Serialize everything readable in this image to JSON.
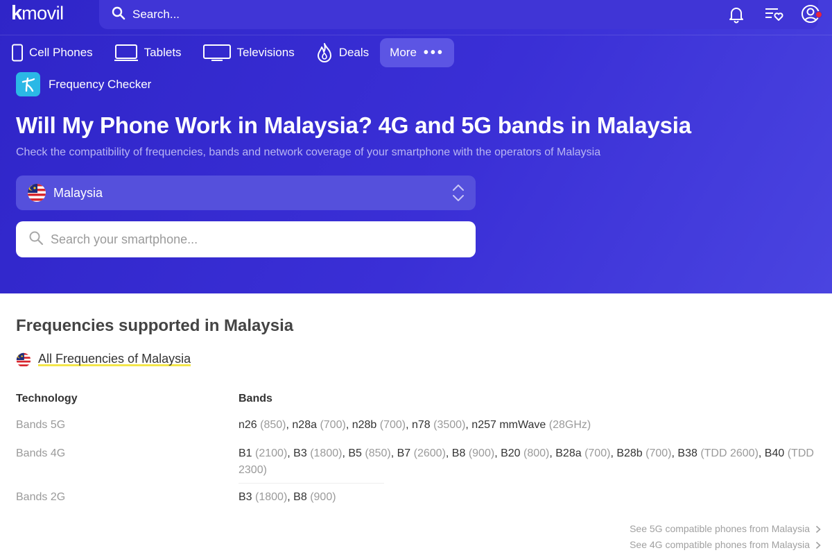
{
  "brand": {
    "logo_k": "k",
    "logo_rest": "movil"
  },
  "topbar": {
    "search_label": "Search...",
    "icons": [
      "bell-icon",
      "wishlist-icon",
      "user-account-icon"
    ]
  },
  "nav": {
    "items": [
      {
        "label": "Cell Phones",
        "icon": "phone-icon"
      },
      {
        "label": "Tablets",
        "icon": "tablet-icon"
      },
      {
        "label": "Televisions",
        "icon": "tv-icon"
      },
      {
        "label": "Deals",
        "icon": "flame-icon"
      }
    ],
    "more_label": "More",
    "more_dots": "•••"
  },
  "tool": {
    "label": "Frequency Checker"
  },
  "hero": {
    "title": "Will My Phone Work in Malaysia? 4G and 5G bands in Malaysia",
    "subtitle": "Check the compatibility of frequencies, bands and network coverage of your smartphone with the operators of Malaysia",
    "country_selected": "Malaysia",
    "phone_search_placeholder": "Search your smartphone..."
  },
  "frequencies": {
    "section_title": "Frequencies supported in Malaysia",
    "all_label": "All Frequencies of Malaysia",
    "col_technology": "Technology",
    "col_bands": "Bands",
    "rows": [
      {
        "technology": "Bands 5G",
        "bands": [
          {
            "b": "n26",
            "f": "(850)"
          },
          {
            "b": "n28a",
            "f": "(700)"
          },
          {
            "b": "n28b",
            "f": "(700)"
          },
          {
            "b": "n78",
            "f": "(3500)"
          },
          {
            "b": "n257 mmWave",
            "f": "(28GHz)"
          }
        ]
      },
      {
        "technology": "Bands 4G",
        "bands": [
          {
            "b": "B1",
            "f": "(2100)"
          },
          {
            "b": "B3",
            "f": "(1800)"
          },
          {
            "b": "B5",
            "f": "(850)"
          },
          {
            "b": "B7",
            "f": "(2600)"
          },
          {
            "b": "B8",
            "f": "(900)"
          },
          {
            "b": "B20",
            "f": "(800)"
          },
          {
            "b": "B28a",
            "f": "(700)"
          },
          {
            "b": "B28b",
            "f": "(700)"
          },
          {
            "b": "B38",
            "f": "(TDD 2600)"
          },
          {
            "b": "B40",
            "f": "(TDD 2300)"
          }
        ]
      },
      {
        "technology": "Bands 2G",
        "bands": [
          {
            "b": "B3",
            "f": "(1800)"
          },
          {
            "b": "B8",
            "f": "(900)"
          }
        ]
      }
    ],
    "see_5g": "See 5G compatible phones from Malaysia",
    "see_4g": "See 4G compatible phones from Malaysia"
  },
  "colors": {
    "hero_bg": "#3a2fd6",
    "accent_highlight": "#f4e64a",
    "badge": "#e8243c",
    "tool_icon_bg": "#2bb8e6"
  }
}
